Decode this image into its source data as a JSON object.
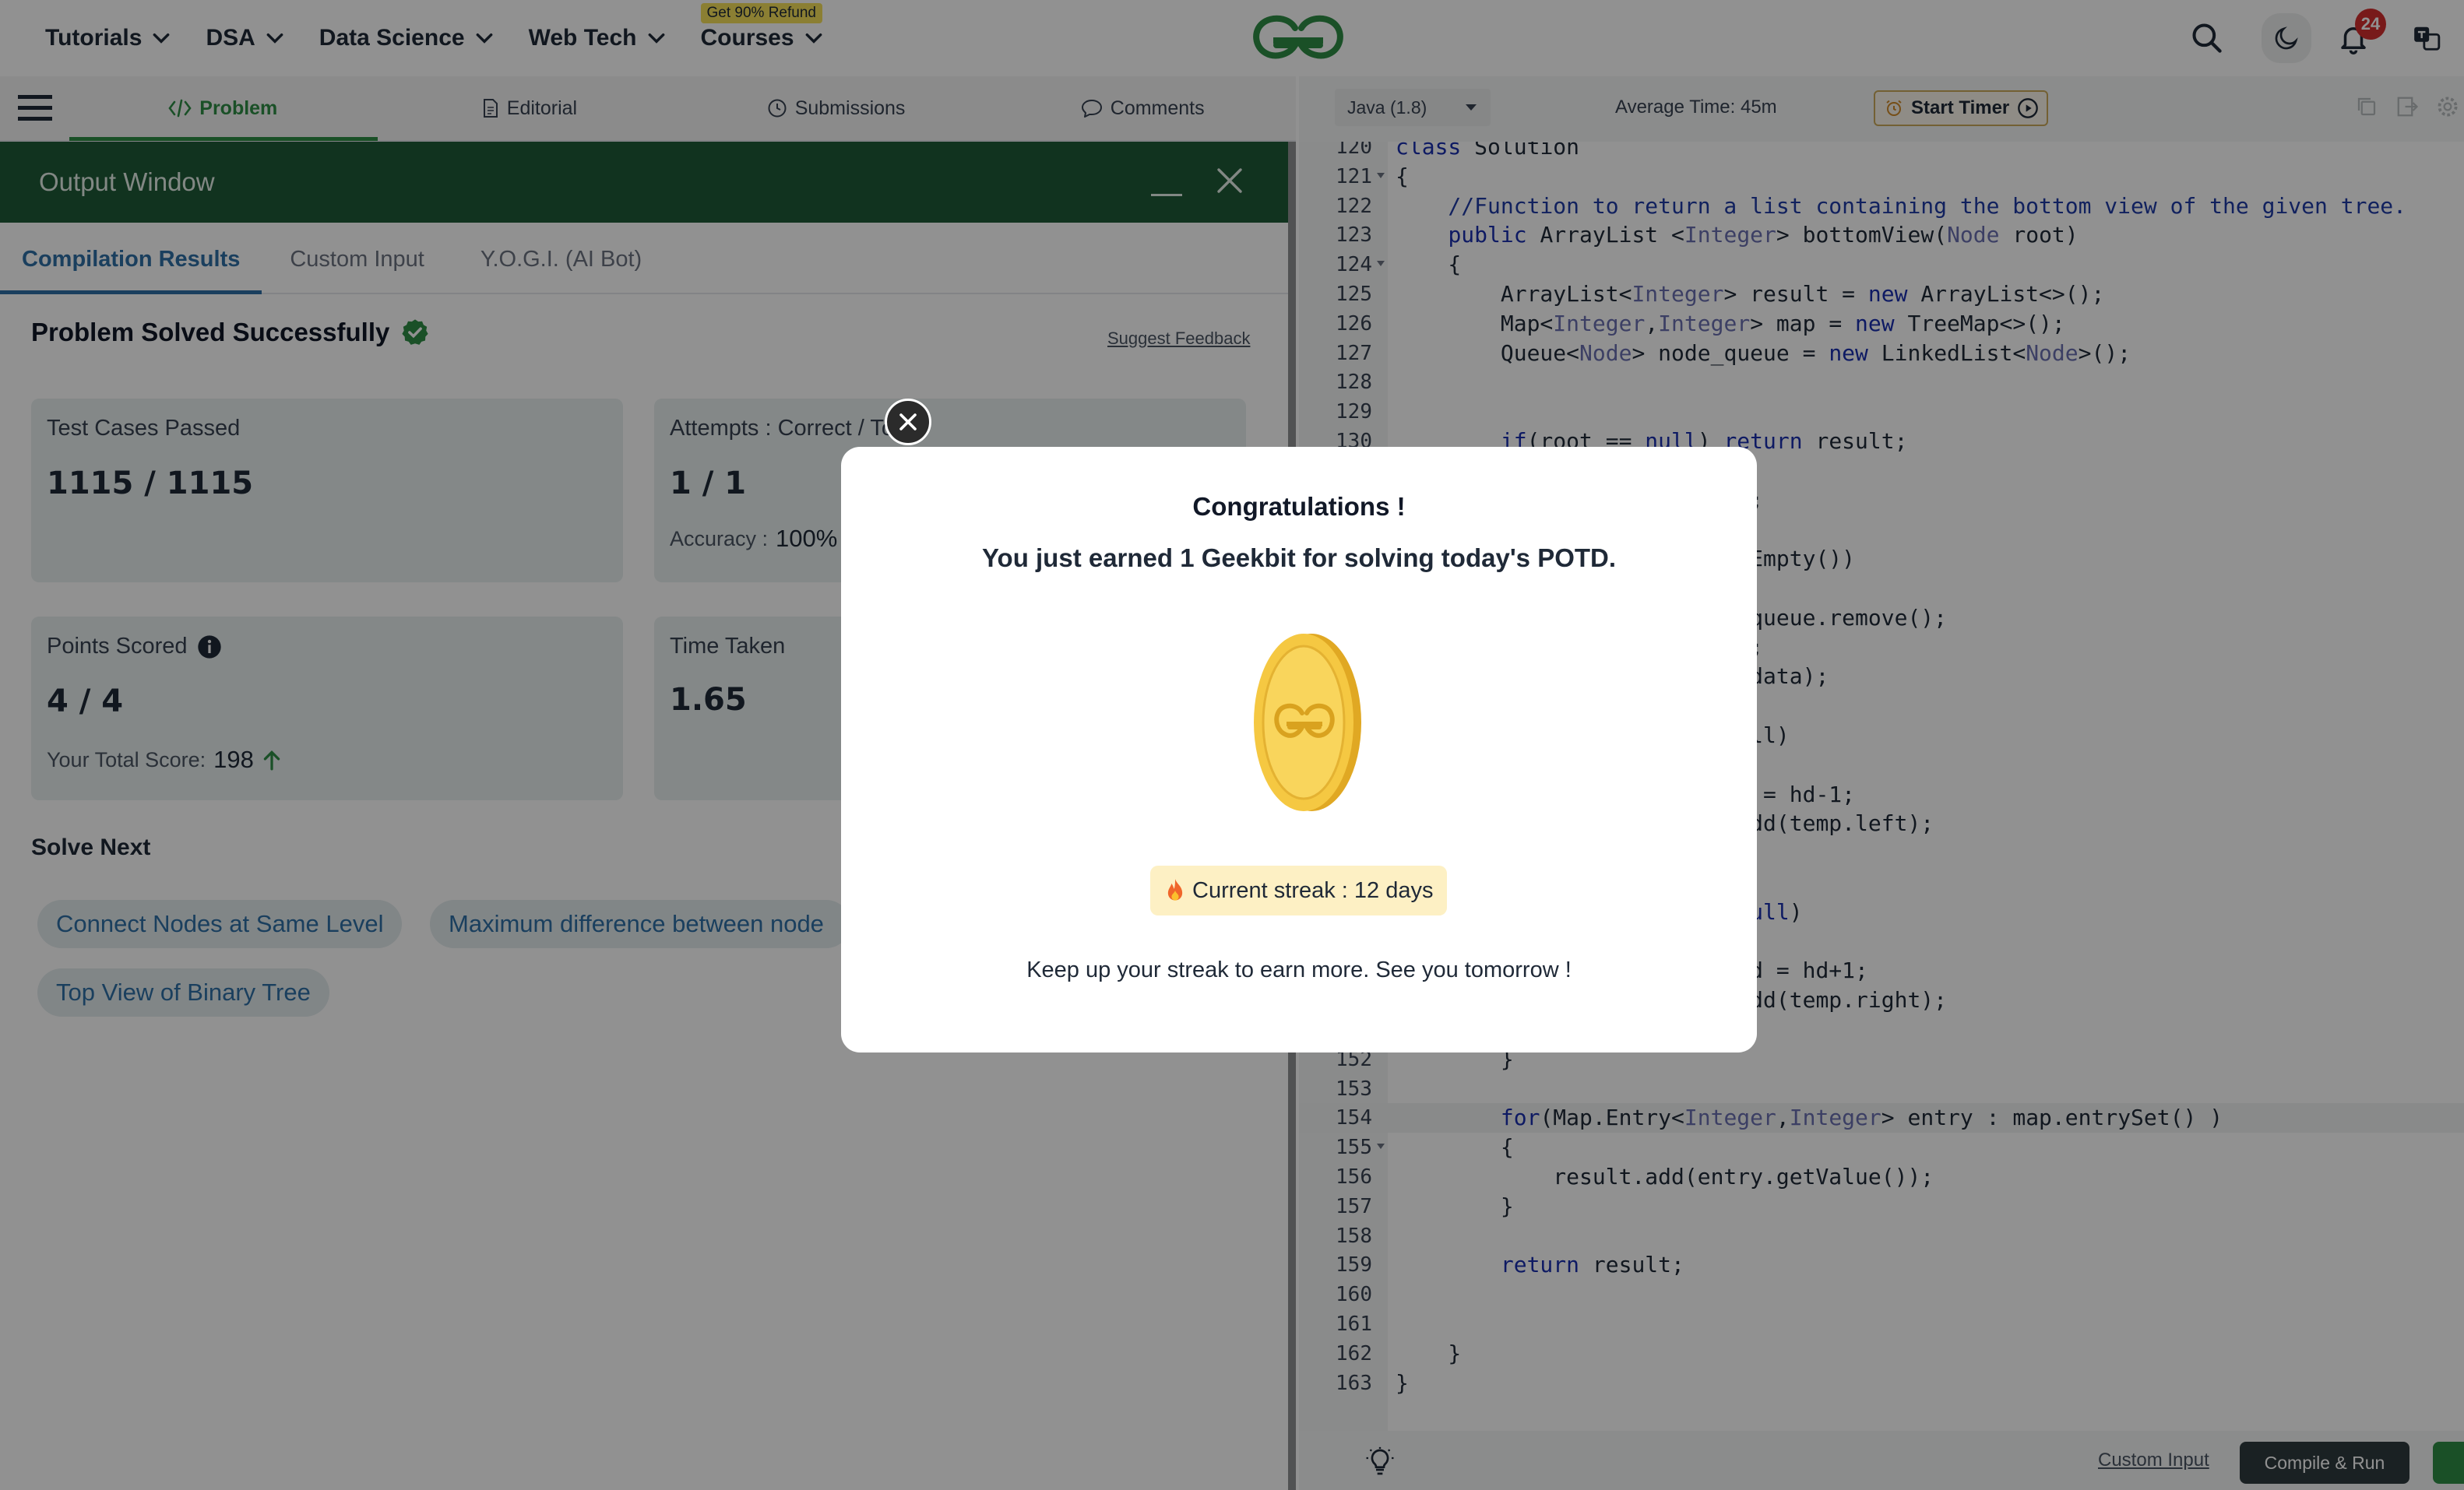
{
  "nav": {
    "items": [
      {
        "label": "Tutorials"
      },
      {
        "label": "DSA"
      },
      {
        "label": "Data Science"
      },
      {
        "label": "Web Tech"
      },
      {
        "label": "Courses",
        "badge": "Get 90% Refund"
      }
    ],
    "notification_count": "24",
    "icons": [
      "search-icon",
      "dark-mode-icon",
      "bell-icon",
      "translate-icon"
    ]
  },
  "problem_tabs": [
    {
      "label": "Problem",
      "icon": "code-icon",
      "active": true
    },
    {
      "label": "Editorial",
      "icon": "document-icon"
    },
    {
      "label": "Submissions",
      "icon": "clock-icon"
    },
    {
      "label": "Comments",
      "icon": "chat-icon"
    }
  ],
  "output": {
    "title": "Output Window",
    "tabs": [
      "Compilation Results",
      "Custom Input",
      "Y.O.G.I. (AI Bot)"
    ],
    "result_title": "Problem Solved Successfully",
    "suggest_feedback": "Suggest Feedback",
    "cards": {
      "test_cases": {
        "label": "Test Cases Passed",
        "value": "1115 / 1115"
      },
      "attempts": {
        "label": "Attempts : Correct / Total",
        "value": "1 / 1",
        "accuracy_label": "Accuracy :",
        "accuracy_value": "100%"
      },
      "points": {
        "label": "Points Scored",
        "value": "4 / 4",
        "total_label": "Your Total Score:",
        "total_value": "198"
      },
      "time": {
        "label": "Time Taken",
        "value": "1.65"
      }
    },
    "solve_next_title": "Solve Next",
    "solve_next": [
      "Connect Nodes at Same Level",
      "Maximum difference between node",
      "Top View of Binary Tree"
    ]
  },
  "editor": {
    "language": "Java (1.8)",
    "average_time": "Average Time: 45m",
    "timer_label": "Start Timer",
    "custom_input": "Custom Input",
    "compile_run": "Compile & Run",
    "lines": [
      {
        "n": "120",
        "t": "class Solution"
      },
      {
        "n": "121",
        "t": "{",
        "fold": true
      },
      {
        "n": "122",
        "t": "    //Function to return a list containing the bottom view of the given tree."
      },
      {
        "n": "123",
        "t": "    public ArrayList <Integer> bottomView(Node root)"
      },
      {
        "n": "124",
        "t": "    {",
        "fold": true
      },
      {
        "n": "125",
        "t": "        ArrayList<Integer> result = new ArrayList<>();"
      },
      {
        "n": "126",
        "t": "        Map<Integer,Integer> map = new TreeMap<>();"
      },
      {
        "n": "127",
        "t": "        Queue<Node> node_queue = new LinkedList<Node>();"
      },
      {
        "n": "128",
        "t": ""
      },
      {
        "n": "129",
        "t": ""
      },
      {
        "n": "130",
        "t": "        if(root == null) return result;"
      },
      {
        "n": "",
        "t": ""
      },
      {
        "n": "",
        "t": "                          );"
      },
      {
        "n": "",
        "t": ""
      },
      {
        "n": "",
        "t": "                          sEmpty())"
      },
      {
        "n": "",
        "t": ""
      },
      {
        "n": "",
        "t": "                          _queue.remove();"
      },
      {
        "n": "",
        "t": "                          d;"
      },
      {
        "n": "",
        "t": "                          .data);"
      },
      {
        "n": "",
        "t": ""
      },
      {
        "n": "",
        "t": "                          ull)"
      },
      {
        "n": "",
        "t": ""
      },
      {
        "n": "",
        "t": "                          d = hd-1;"
      },
      {
        "n": "",
        "t": "                          add(temp.left);"
      },
      {
        "n": "",
        "t": ""
      },
      {
        "n": "",
        "t": ""
      },
      {
        "n": "",
        "t": "                          null)"
      },
      {
        "n": "",
        "t": ""
      },
      {
        "n": "",
        "t": "                          nd = hd+1;"
      },
      {
        "n": "",
        "t": "                          add(temp.right);"
      },
      {
        "n": "151",
        "t": "            }"
      },
      {
        "n": "152",
        "t": "        }"
      },
      {
        "n": "153",
        "t": ""
      },
      {
        "n": "154",
        "t": "        for(Map.Entry<Integer,Integer> entry : map.entrySet() )",
        "hl": true
      },
      {
        "n": "155",
        "t": "        {",
        "fold": true
      },
      {
        "n": "156",
        "t": "            result.add(entry.getValue());"
      },
      {
        "n": "157",
        "t": "        }"
      },
      {
        "n": "158",
        "t": ""
      },
      {
        "n": "159",
        "t": "        return result;"
      },
      {
        "n": "160",
        "t": ""
      },
      {
        "n": "161",
        "t": ""
      },
      {
        "n": "162",
        "t": "    }"
      },
      {
        "n": "163",
        "t": "}"
      }
    ]
  },
  "modal": {
    "title": "Congratulations !",
    "subtitle": "You just earned 1 Geekbit for solving today's POTD.",
    "streak": "Current streak : 12 days",
    "footer": "Keep up your streak to earn more. See you tomorrow !"
  },
  "colors": {
    "brand_green": "#2f8d46",
    "output_header": "#1f5a38",
    "link_blue": "#2f6fa5",
    "card_bg": "#e8f0ef",
    "coin_gold": "#f5c842"
  }
}
